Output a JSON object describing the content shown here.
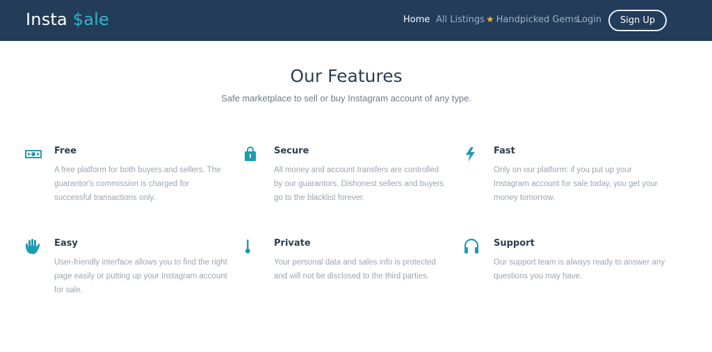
{
  "nav": {
    "logo_main": "Insta ",
    "logo_accent": "$ale",
    "home": "Home",
    "listings": "All Listings",
    "gems": "Handpicked Gems",
    "login": "Login",
    "signup": "Sign Up"
  },
  "section": {
    "title": "Our Features",
    "subtitle": "Safe marketplace to sell or buy Instagram account of any type."
  },
  "features": [
    {
      "icon": "money-icon",
      "title": "Free",
      "text": "A free platform for both buyers and sellers. The guarantor's commission is charged for successful transactions only."
    },
    {
      "icon": "lock-icon",
      "title": "Secure",
      "text": "All money and account transfers are controlled by our guarantors. Dishonest sellers and buyers go to the blacklist forever."
    },
    {
      "icon": "lightning-icon",
      "title": "Fast",
      "text": "Only on our platform: if you put up your Instagram account for sale today, you get your money tomorrow."
    },
    {
      "icon": "hand-icon",
      "title": "Easy",
      "text": "User-friendly interface allows you to find the right page easily or putting up your Instagram account for sale."
    },
    {
      "icon": "thermometer-icon",
      "title": "Private",
      "text": "Your personal data and sales info is protected and will not be disclosed to the third parties."
    },
    {
      "icon": "headphones-icon",
      "title": "Support",
      "text": "Our support team is always ready to answer any questions you may have."
    }
  ],
  "colors": {
    "nav_bg": "#233c5a",
    "accent": "#1f9bb0",
    "star": "#f0b63b"
  }
}
